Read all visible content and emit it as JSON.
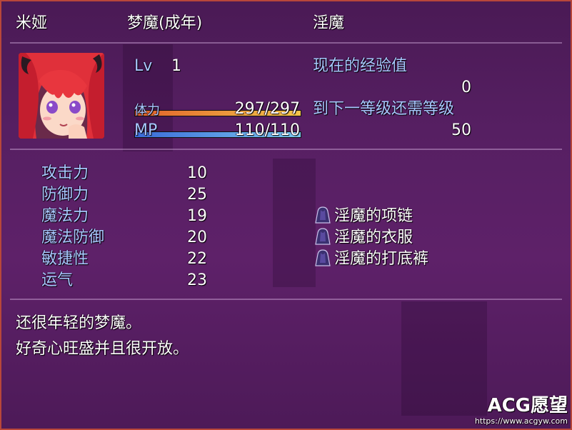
{
  "actor": {
    "name": "米娅",
    "class": "梦魔(成年)",
    "nickname": "淫魔",
    "level_label": "Lv",
    "level": "1",
    "hp_label": "体力",
    "hp": "297/297",
    "hp_fraction": 1.0,
    "mp_label": "MP",
    "mp": "110/110",
    "mp_fraction": 1.0,
    "exp_label": "现在的经验值",
    "exp": "0",
    "next_label": "到下一等级还需等级",
    "next": "50"
  },
  "params": [
    {
      "label": "攻击力",
      "value": "10"
    },
    {
      "label": "防御力",
      "value": "25"
    },
    {
      "label": "魔法力",
      "value": "19"
    },
    {
      "label": "魔法防御",
      "value": "20"
    },
    {
      "label": "敏捷性",
      "value": "22"
    },
    {
      "label": "运气",
      "value": "23"
    }
  ],
  "equipment": [
    {
      "name": "淫魔的项链",
      "icon": "cloak-icon"
    },
    {
      "name": "淫魔的衣服",
      "icon": "cloak-icon"
    },
    {
      "name": "淫魔的打底裤",
      "icon": "cloak-icon"
    }
  ],
  "profile": {
    "line1": "还很年轻的梦魔。",
    "line2": "好奇心旺盛并且很开放。"
  },
  "colors": {
    "window_border": "#b8473a",
    "system_text": "#a8c8ff",
    "hp_gauge_start": "#e0602a",
    "hp_gauge_end": "#f5c54a",
    "mp_gauge_start": "#3a6ad8",
    "mp_gauge_end": "#7ac8f0"
  },
  "watermark": {
    "brand": "ACG愿望",
    "url": "https://www.acgyw.com"
  }
}
